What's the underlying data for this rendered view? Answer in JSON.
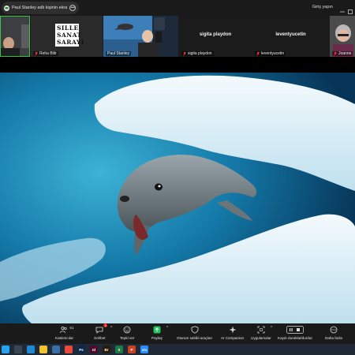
{
  "topbar": {
    "share_text": "Paul Stanley adlı kişinin ekra",
    "signin": "Giriş yapın"
  },
  "gallery": {
    "tiles": [
      {
        "name": ""
      },
      {
        "name": "Reha Bilir",
        "logo_lines": [
          "SILLE",
          "SANAT",
          "SARAYI"
        ]
      },
      {
        "name": "Paul Stanley"
      },
      {
        "name": "sigita playdon",
        "center": "sigita playdon"
      },
      {
        "name": "leventyucetin",
        "center": "leventyucetin"
      },
      {
        "name": "Joanne"
      }
    ]
  },
  "toolbar": {
    "participants": {
      "label": "Katılımcılar",
      "count": "61"
    },
    "chat": {
      "label": "Sohbet",
      "badge": "3"
    },
    "react": {
      "label": "Tepki ver"
    },
    "share": {
      "label": "Paylaş"
    },
    "host_tools": {
      "label": "Oturum sahibi araçları"
    },
    "companion": {
      "label": "AI Companion"
    },
    "apps": {
      "label": "Uygulamalar"
    },
    "record": {
      "label": "Kaydı duraklat/durdur"
    },
    "more": {
      "label": "Daha fazla"
    }
  },
  "taskbar": {
    "apps": [
      {
        "icon": "windows-start-icon",
        "color": "#2aa0f0"
      },
      {
        "icon": "search-icon",
        "color": "#3b4756"
      },
      {
        "icon": "edge-icon",
        "color": "#1f8ad2"
      },
      {
        "icon": "file-explorer-icon",
        "color": "#f2c12e"
      },
      {
        "icon": "store-icon",
        "color": "#3b6ea5"
      },
      {
        "icon": "chrome-icon",
        "color": "#e9493c"
      },
      {
        "icon": "photoshop-icon",
        "color": "#0c2a4a",
        "text": "Ps"
      },
      {
        "icon": "indesign-icon",
        "color": "#4a0a2a",
        "text": "Id"
      },
      {
        "icon": "bridge-icon",
        "color": "#2a1a0a",
        "text": "Br"
      },
      {
        "icon": "excel-icon",
        "color": "#1e7a45",
        "text": "X"
      },
      {
        "icon": "powerpoint-icon",
        "color": "#c8431f",
        "text": "P"
      },
      {
        "icon": "zoom-icon",
        "color": "#2d8cff",
        "text": "zm"
      }
    ]
  },
  "colors": {
    "active_speaker": "#3ec14b",
    "share_green": "#22c35e",
    "badge_red": "#e02020"
  }
}
